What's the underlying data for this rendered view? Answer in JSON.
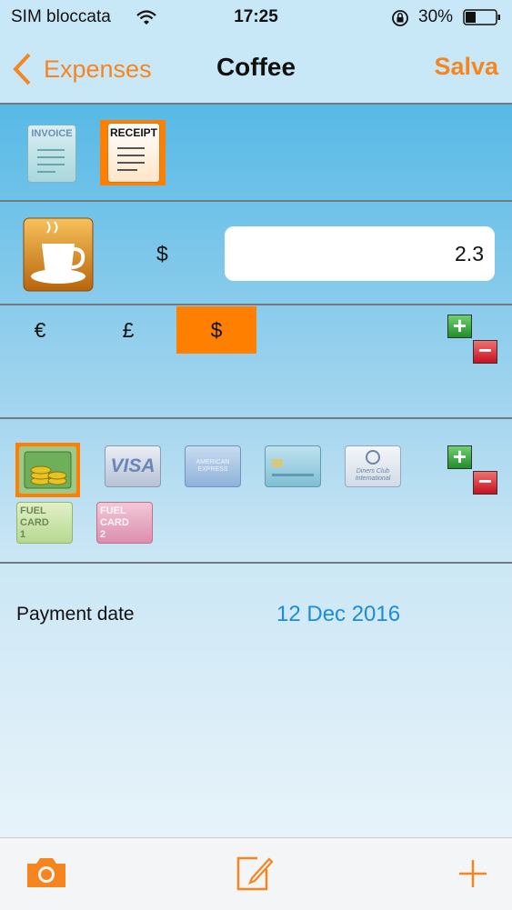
{
  "status": {
    "carrier": "SIM bloccata",
    "time": "17:25",
    "battery": "30%"
  },
  "nav": {
    "back_label": "Expenses",
    "title": "Coffee",
    "save_label": "Salva"
  },
  "document_types": [
    {
      "label": "INVOICE",
      "selected": false
    },
    {
      "label": "RECEIPT",
      "selected": true
    }
  ],
  "amount": {
    "currency_symbol": "$",
    "value": "2.3",
    "category_icon": "coffee-cup-icon"
  },
  "currencies": [
    {
      "symbol": "€",
      "selected": false
    },
    {
      "symbol": "£",
      "selected": false
    },
    {
      "symbol": "$",
      "selected": true
    }
  ],
  "payment_methods": [
    {
      "name": "cash-coins-icon",
      "selected": true
    },
    {
      "name": "visa-card-icon",
      "label": "VISA",
      "selected": false
    },
    {
      "name": "american-express-card-icon",
      "label": "AMERICAN EXPRESS",
      "selected": false
    },
    {
      "name": "credit-card-icon",
      "selected": false
    },
    {
      "name": "diners-club-card-icon",
      "label": "Diners Club International",
      "selected": false
    },
    {
      "name": "fuel-card-1-icon",
      "label": "FUEL CARD 1",
      "selected": false
    },
    {
      "name": "fuel-card-2-icon",
      "label": "FUEL CARD 2",
      "selected": false
    }
  ],
  "payment_date": {
    "label": "Payment date",
    "value": "12 Dec 2016"
  },
  "toolbar": {
    "icons": [
      "camera-icon",
      "compose-icon",
      "add-icon"
    ]
  },
  "colors": {
    "accent": "#f5861f",
    "date_blue": "#1a8cdd",
    "selected_bg": "#ff8000"
  }
}
